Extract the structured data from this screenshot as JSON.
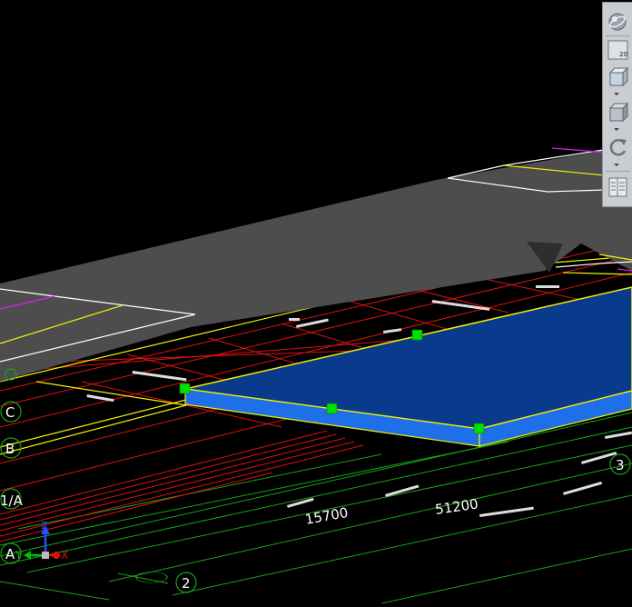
{
  "viewport": {
    "grid_labels": {
      "c": "C",
      "b": "B",
      "one_a": "1/A",
      "a": "A",
      "two": "2",
      "three": "3"
    },
    "dimensions": {
      "d1": "15700",
      "d2": "51200"
    },
    "ucs": {
      "x": "X",
      "y": "Y",
      "z": "Z"
    },
    "colors": {
      "background": "#000000",
      "slab_blue": "#0a3a8c",
      "slab_edge": "#1f6fe8",
      "grip_green": "#00e000",
      "grid_red": "#e01010",
      "grid_green": "#16a616",
      "highlight_yellow": "#f2f200",
      "magenta": "#e020e0",
      "gray_plane": "#4a4a4a"
    }
  },
  "toolbar": {
    "zoom_value": "20",
    "icons": [
      "orbit-globe-icon",
      "zoom-window-icon",
      "view-cube-icon",
      "visual-style-icon",
      "rotate-icon",
      "layout-grid-icon"
    ]
  }
}
